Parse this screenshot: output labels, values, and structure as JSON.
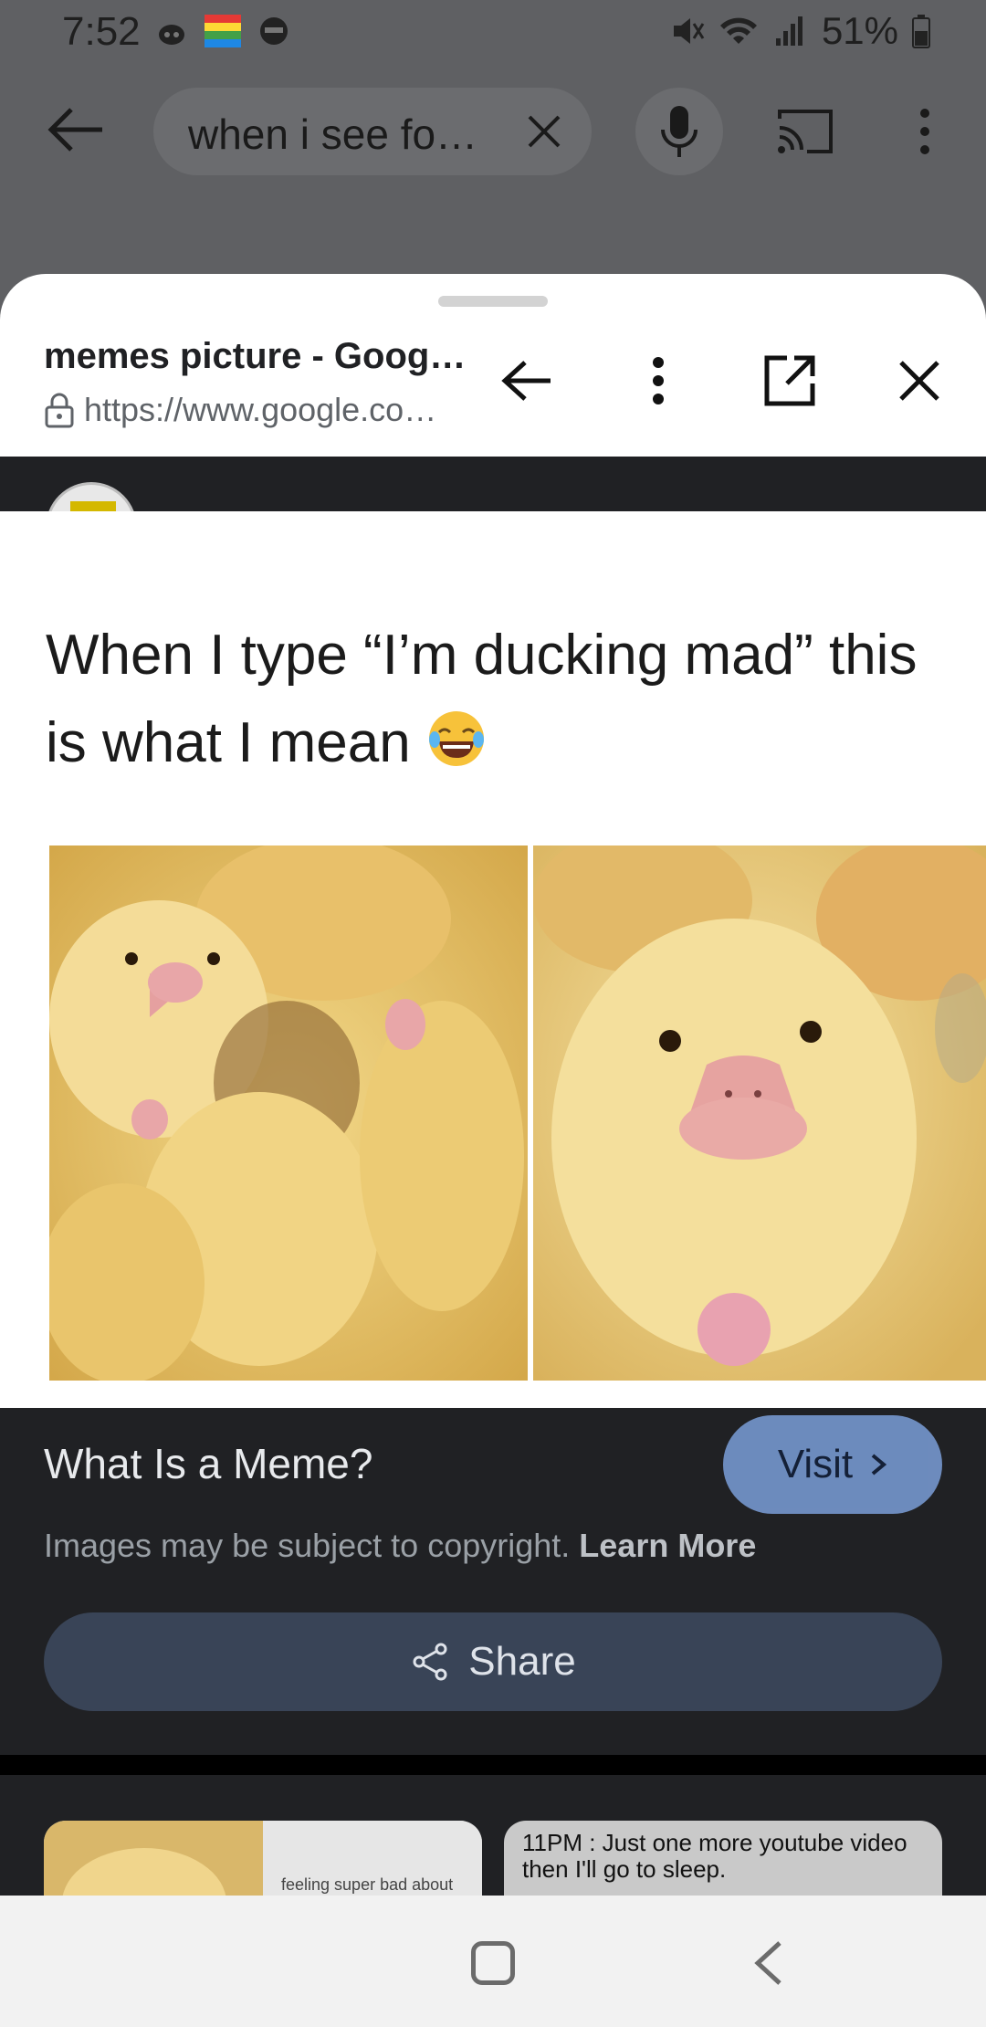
{
  "status_bar": {
    "time": "7:52",
    "battery_pct": "51%",
    "icons_left": [
      "bug-app-icon",
      "colorful-app-icon",
      "mask-app-icon"
    ],
    "icons_right": [
      "mute-icon",
      "wifi-icon",
      "signal-icon",
      "battery-icon"
    ]
  },
  "search": {
    "query": "when i see fo…"
  },
  "sheet": {
    "title": "memes picture - Goog…",
    "url": "https://www.google.co…"
  },
  "meme": {
    "caption_line1": "When I type “I’m ducking mad” this",
    "caption_line2": "is what I mean"
  },
  "info": {
    "title": "What Is a Meme?",
    "visit_label": "Visit",
    "copyright_text": "Images may be subject to copyright.",
    "learn_more": "Learn More",
    "share_label": "Share"
  },
  "related": {
    "left_caption": "feeling super bad about",
    "right_caption": "11PM : Just one more youtube video then I'll go to sleep."
  },
  "colors": {
    "dim_overlay": "#5f6063",
    "panel_dark": "#202124",
    "visit_blue": "#8ab4f8",
    "share_bg": "#394457"
  }
}
